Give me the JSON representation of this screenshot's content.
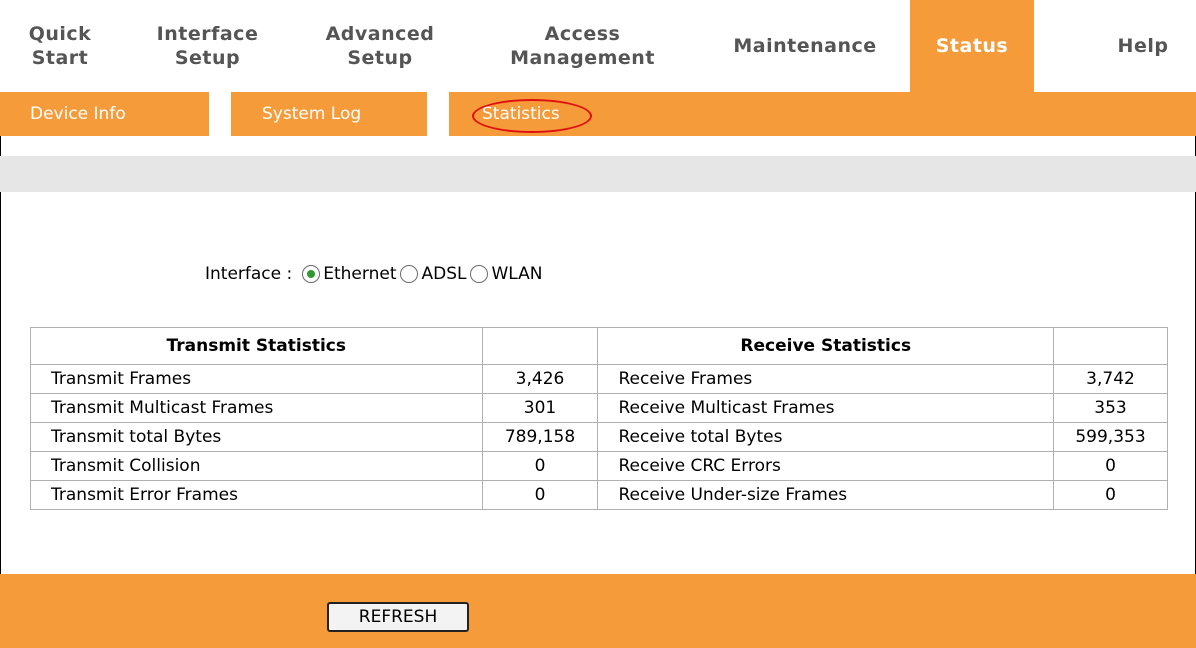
{
  "nav": {
    "items": [
      {
        "label": "Quick\nStart",
        "active": false
      },
      {
        "label": "Interface\nSetup",
        "active": false
      },
      {
        "label": "Advanced\nSetup",
        "active": false
      },
      {
        "label": "Access\nManagement",
        "active": false
      },
      {
        "label": "Maintenance",
        "active": false
      },
      {
        "label": "Status",
        "active": true
      },
      {
        "label": "Help",
        "active": false
      }
    ]
  },
  "subnav": {
    "items": [
      {
        "label": "Device Info"
      },
      {
        "label": "System Log"
      },
      {
        "label": "Statistics",
        "highlighted": true
      }
    ]
  },
  "interface": {
    "label": "Interface :",
    "options": [
      {
        "label": "Ethernet",
        "checked": true
      },
      {
        "label": "ADSL",
        "checked": false
      },
      {
        "label": "WLAN",
        "checked": false
      }
    ]
  },
  "table": {
    "headers": [
      "Transmit Statistics",
      "",
      "Receive Statistics",
      ""
    ],
    "rows": [
      [
        "Transmit Frames",
        "3,426",
        "Receive Frames",
        "3,742"
      ],
      [
        "Transmit Multicast Frames",
        "301",
        "Receive Multicast Frames",
        "353"
      ],
      [
        "Transmit total Bytes",
        "789,158",
        "Receive total Bytes",
        "599,353"
      ],
      [
        "Transmit Collision",
        "0",
        "Receive CRC Errors",
        "0"
      ],
      [
        "Transmit Error Frames",
        "0",
        "Receive Under-size Frames",
        "0"
      ]
    ]
  },
  "refresh_label": "REFRESH",
  "colors": {
    "accent": "#f59b3a",
    "highlight_circle": "#e01010",
    "radio_checked": "#2e9a2e"
  }
}
